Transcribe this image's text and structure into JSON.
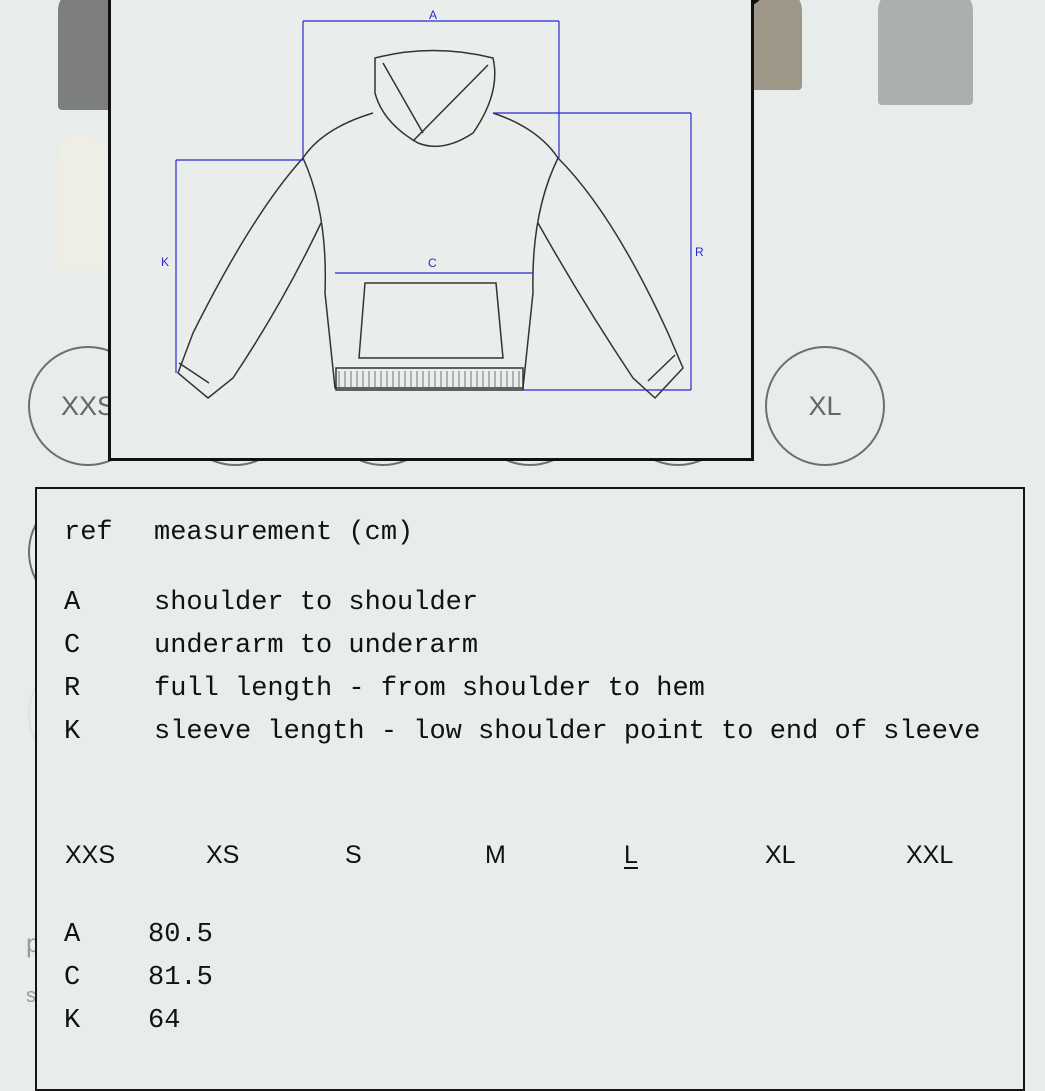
{
  "background": {
    "size_circles": [
      "XXS",
      "XL"
    ],
    "partial_text": [
      "p",
      "s"
    ]
  },
  "size_chart_image": {
    "labels": {
      "a": "A",
      "c": "C",
      "k": "K",
      "r": "R"
    },
    "line_color": "#2a2ad0"
  },
  "measurement_table": {
    "header": {
      "ref": "ref",
      "measurement": "measurement (cm)"
    },
    "rows": [
      {
        "ref": "A",
        "desc": "shoulder to shoulder"
      },
      {
        "ref": "C",
        "desc": "underarm to underarm"
      },
      {
        "ref": "R",
        "desc": "full length - from shoulder to hem"
      },
      {
        "ref": "K",
        "desc": "sleeve length - low shoulder point to end of sleeve"
      }
    ],
    "sizes": [
      "XXS",
      "XS",
      "S",
      "M",
      "L",
      "XL",
      "XXL"
    ],
    "selected_size": "L",
    "values": [
      {
        "ref": "A",
        "value": "80.5"
      },
      {
        "ref": "C",
        "value": "81.5"
      },
      {
        "ref": "K",
        "value": "64"
      }
    ]
  }
}
